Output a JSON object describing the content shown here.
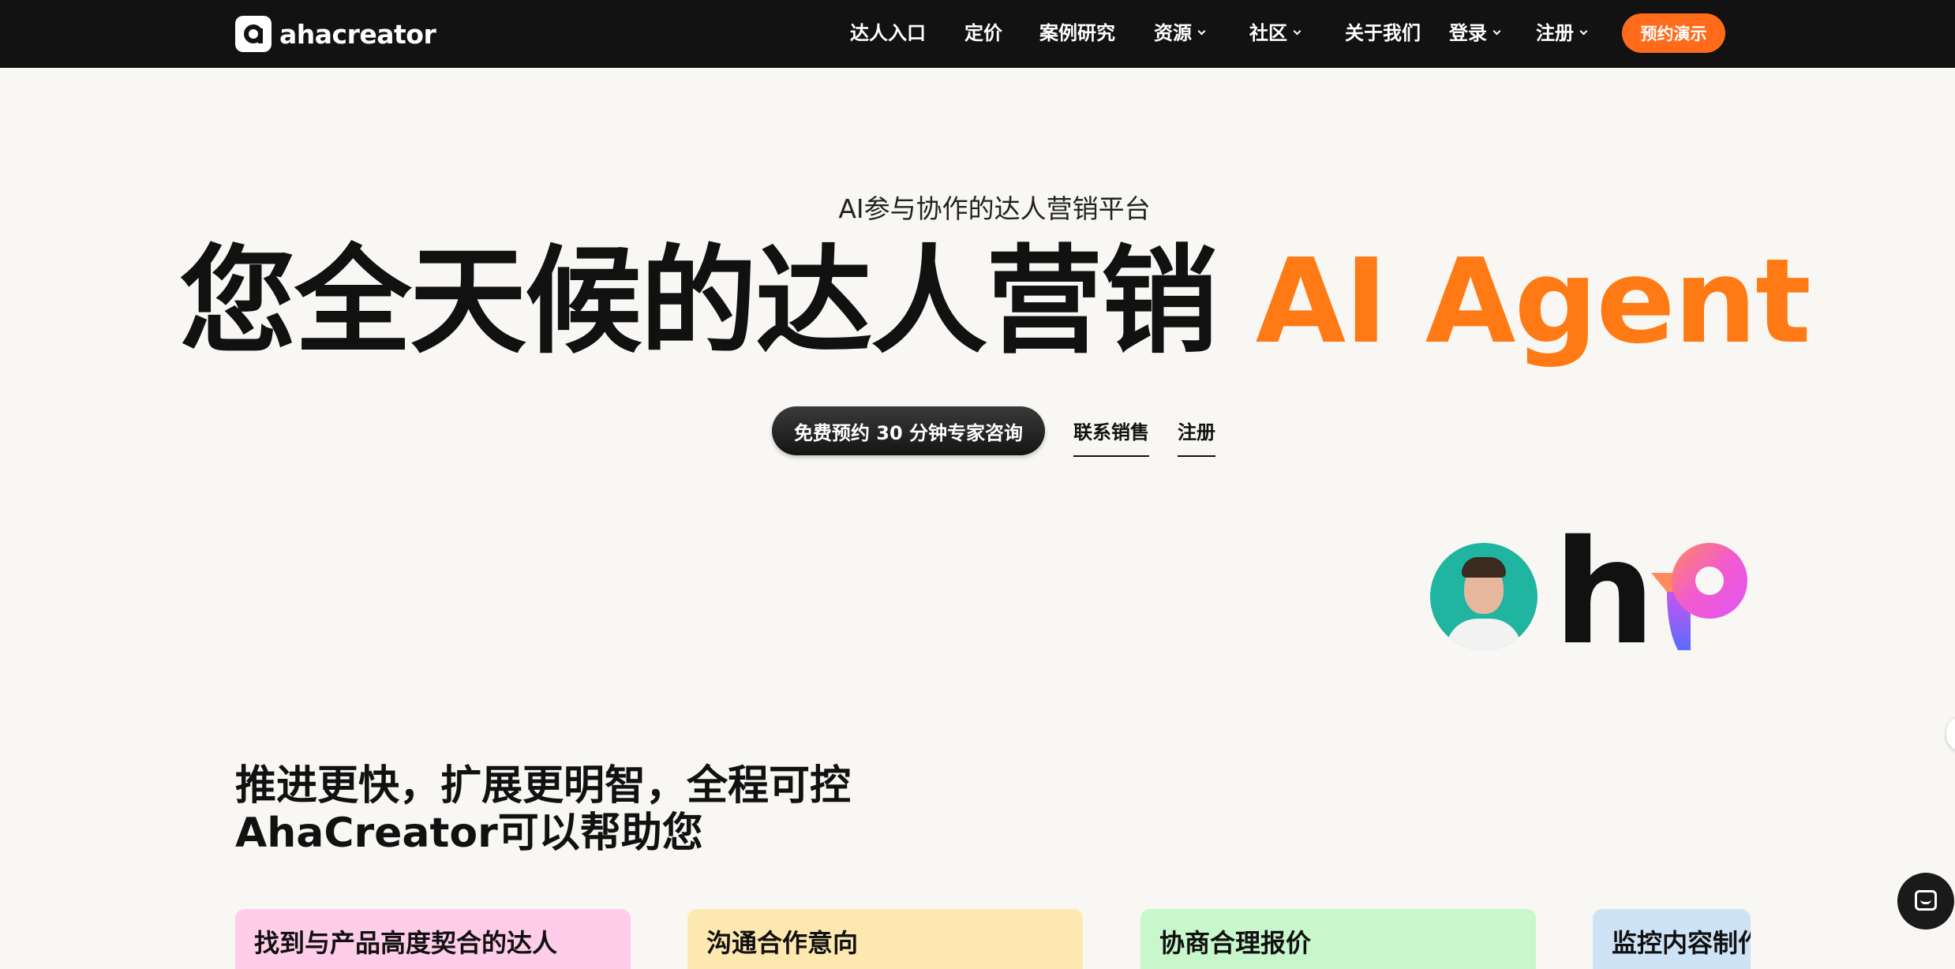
{
  "nav": {
    "logo_text": "ahacreator",
    "items": [
      {
        "label": "达人入口",
        "has_dropdown": false
      },
      {
        "label": "定价",
        "has_dropdown": false
      },
      {
        "label": "案例研究",
        "has_dropdown": false
      },
      {
        "label": "资源",
        "has_dropdown": true
      },
      {
        "label": "社区",
        "has_dropdown": true
      },
      {
        "label": "关于我们",
        "has_dropdown": false
      },
      {
        "label": "登录",
        "has_dropdown": true
      },
      {
        "label": "注册",
        "has_dropdown": true
      }
    ],
    "demo_button": "预约演示"
  },
  "hero": {
    "subtitle": "AI参与协作的达人营销平台",
    "title_main": "您全天候的达人营销",
    "title_accent": "AI Agent",
    "cta_primary": "免费预约 30 分钟专家咨询",
    "link_sales": "联系销售",
    "link_register": "注册"
  },
  "section": {
    "title_line1": "推进更快，扩展更明智，全程可控",
    "title_line2": "AhaCreator可以帮助您",
    "cards": [
      {
        "label": "找到与产品高度契合的达人",
        "color": "#ffccea"
      },
      {
        "label": "沟通合作意向",
        "color": "#fde9b0"
      },
      {
        "label": "协商合理报价",
        "color": "#c8f7cc"
      },
      {
        "label": "监控内容制作",
        "color": "#cfe3f7"
      }
    ]
  },
  "colors": {
    "accent": "#ff7a14",
    "nav_bg": "#121212",
    "page_bg": "#f8f7f4",
    "demo_button": "#ff6b1a"
  },
  "icons": [
    "logo-icon",
    "chevron-down-icon",
    "chat-icon"
  ]
}
